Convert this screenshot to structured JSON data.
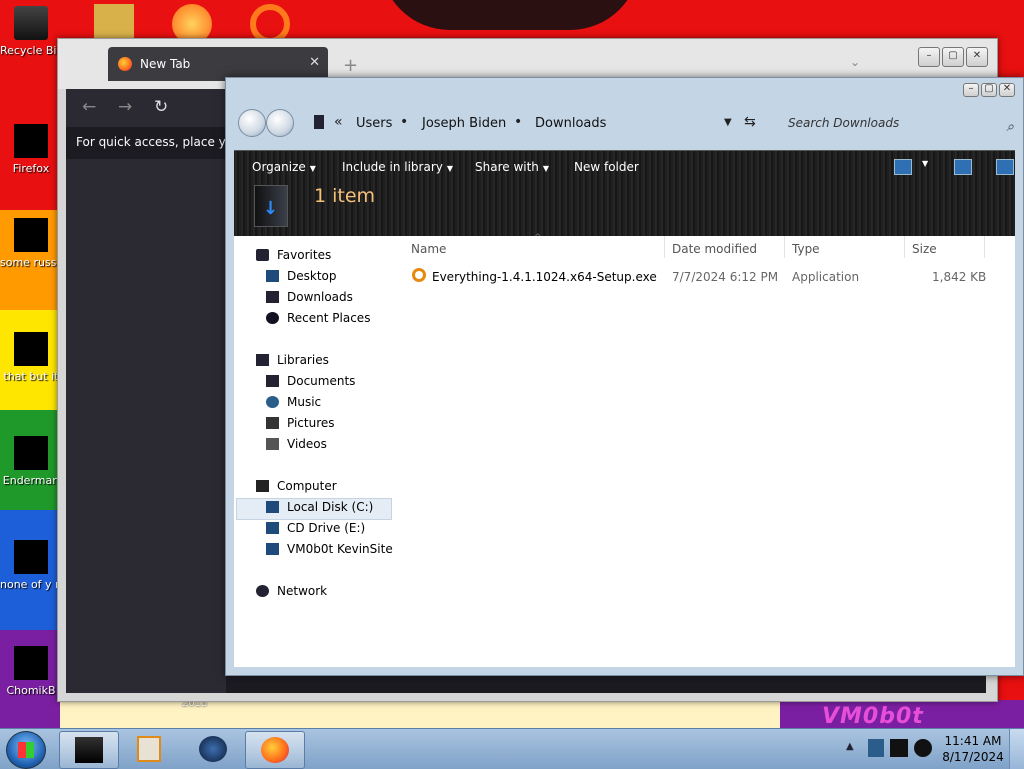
{
  "desktop": {
    "wallpaper_year": "2015",
    "wallpaper_brand": "VM0b0t",
    "icons": [
      {
        "label": "Recycle Bin",
        "icon": "recycle-bin-icon"
      },
      {
        "label": "Firefox",
        "icon": "firefox-icon"
      },
      {
        "label": "some russ ran a ra",
        "icon": "file-icon"
      },
      {
        "label": "that but it",
        "icon": "file-icon"
      },
      {
        "label": "Enderman",
        "icon": "file-icon"
      },
      {
        "label": "none of y retards kn",
        "icon": "file-icon"
      },
      {
        "label": "ChomikB",
        "icon": "file-icon"
      }
    ]
  },
  "browser": {
    "tab_title": "New Tab",
    "quick_access_text": "For quick access, place your",
    "theme": {
      "toolbar": "#2b2a33",
      "body": "#1c1b22"
    }
  },
  "explorer": {
    "breadcrumb": [
      "Users",
      "Joseph Biden",
      "Downloads"
    ],
    "search_placeholder": "Search Downloads",
    "commands": {
      "organize": "Organize",
      "include_in_library": "Include in library",
      "share_with": "Share with",
      "new_folder": "New folder"
    },
    "item_count": "1 item",
    "nav": {
      "favorites": {
        "label": "Favorites",
        "items": [
          "Desktop",
          "Downloads",
          "Recent Places"
        ]
      },
      "libraries": {
        "label": "Libraries",
        "items": [
          "Documents",
          "Music",
          "Pictures",
          "Videos"
        ]
      },
      "computer": {
        "label": "Computer",
        "items": [
          "Local Disk (C:)",
          "CD Drive (E:)",
          "VM0b0t KevinSite"
        ]
      },
      "network": {
        "label": "Network"
      }
    },
    "columns": {
      "name": "Name",
      "date_modified": "Date modified",
      "type": "Type",
      "size": "Size"
    },
    "files": [
      {
        "name": "Everything-1.4.1.1024.x64-Setup.exe",
        "date_modified": "7/7/2024 6:12 PM",
        "type": "Application",
        "size": "1,842 KB"
      }
    ]
  },
  "taskbar": {
    "clock": {
      "time": "11:41 AM",
      "date": "8/17/2024"
    },
    "accent": "#7fa2c8"
  }
}
